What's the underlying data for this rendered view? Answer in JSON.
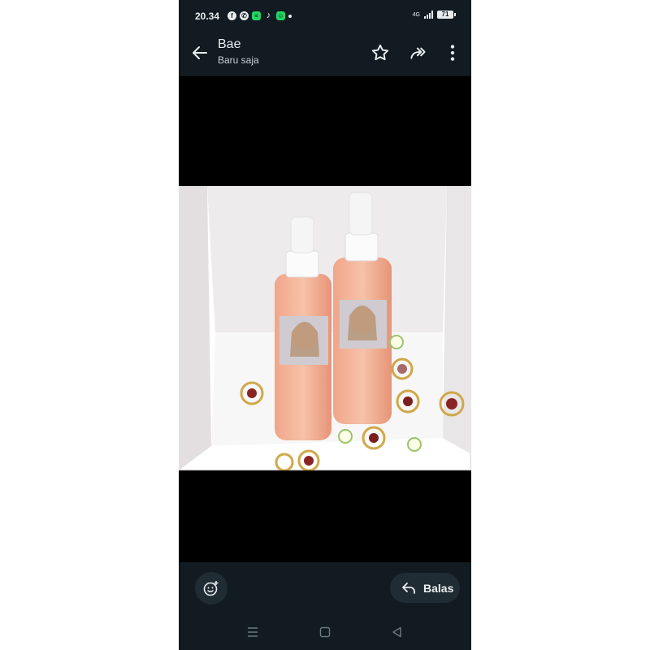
{
  "status_bar": {
    "time": "20.34",
    "notification_icons": [
      "facebook-icon",
      "whatsapp-icon",
      "message-icon",
      "tiktok-icon",
      "chat-icon"
    ],
    "network": "4G",
    "battery": "71"
  },
  "app_bar": {
    "title": "Bae",
    "subtitle": "Baru saja",
    "actions": [
      "star-icon",
      "forward-icon",
      "more-icon"
    ]
  },
  "photo": {
    "description_icon": "image"
  },
  "bottom_bar": {
    "emoji_icon": "emoji-add-icon",
    "reply_label": "Balas"
  },
  "nav_bar": {
    "buttons": [
      "recent-apps-icon",
      "home-icon",
      "back-nav-icon"
    ]
  },
  "colors": {
    "bar_background": "#111b21",
    "button_background": "#202c33",
    "text": "#e9edef"
  }
}
